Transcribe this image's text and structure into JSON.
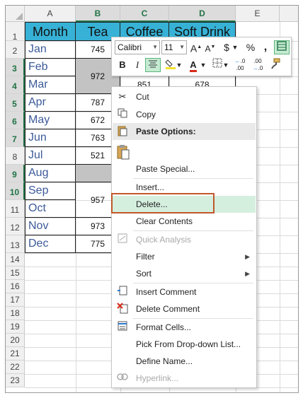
{
  "columns": [
    "A",
    "B",
    "C",
    "D",
    "E"
  ],
  "rows": [
    "1",
    "2",
    "3",
    "4",
    "5",
    "6",
    "7",
    "8",
    "9",
    "10",
    "11",
    "12",
    "13",
    "14",
    "15",
    "16",
    "17",
    "18",
    "19",
    "20",
    "21",
    "22",
    "23"
  ],
  "table_headers": [
    "Month",
    "Tea",
    "Coffee",
    "Soft Drink"
  ],
  "months": [
    "Jan",
    "Feb",
    "Mar",
    "Apr",
    "May",
    "Jun",
    "Jul",
    "Aug",
    "Sep",
    "Oct",
    "Nov",
    "Dec"
  ],
  "tea_values": {
    "jan": "745",
    "feb_mar": "972",
    "apr": "787",
    "may": "672",
    "jun": "763",
    "jul": "521",
    "sep_oct": "957",
    "nov": "973",
    "dec": "775"
  },
  "coffee_values": {
    "mar": "851"
  },
  "softdrink_values": {
    "mar": "678"
  },
  "mini_toolbar": {
    "font_name": "Calibri",
    "font_size": "11",
    "grow_font": "A",
    "shrink_font": "A",
    "currency": "$",
    "percent": "%",
    "comma": ",",
    "bold": "B",
    "italic": "I",
    "font_color": "A",
    "inc_decimal": ".0",
    "dec_decimal": ".00"
  },
  "context_menu": {
    "cut": "Cut",
    "copy": "Copy",
    "paste_options": "Paste Options:",
    "paste_special": "Paste Special...",
    "insert": "Insert...",
    "delete": "Delete...",
    "clear_contents": "Clear Contents",
    "quick_analysis": "Quick Analysis",
    "filter": "Filter",
    "sort": "Sort",
    "insert_comment": "Insert Comment",
    "delete_comment": "Delete Comment",
    "format_cells": "Format Cells...",
    "pick_from_list": "Pick From Drop-down List...",
    "define_name": "Define Name...",
    "hyperlink": "Hyperlink..."
  },
  "colors": {
    "header_fill": "#37b2d6",
    "blank_fill": "#c3c3c3",
    "selection_green": "#217346",
    "hover_green": "#d5efdf",
    "highlight_border": "#c0572b"
  }
}
